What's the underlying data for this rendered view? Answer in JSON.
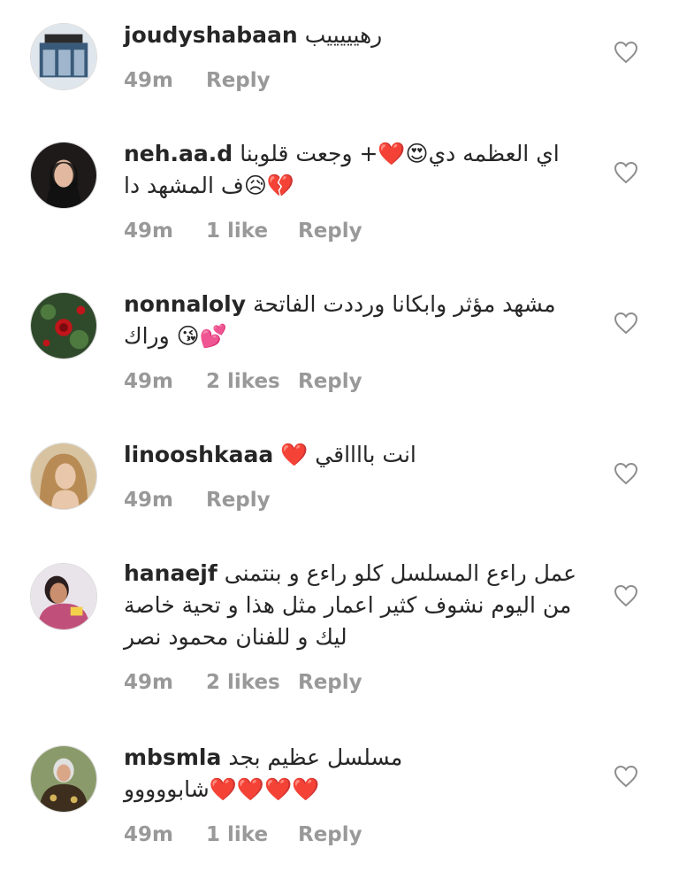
{
  "comments": [
    {
      "username": "joudyshabaan",
      "lines": [
        "رهيييييب"
      ],
      "time": "49m",
      "likes": "",
      "reply": "Reply",
      "avatar_color": "#3a5a7a"
    },
    {
      "username": "neh.aa.d",
      "lines": [
        "اي العظمه دي😍❤️+ وجعت قلوبنا",
        "💔😥ف المشهد دا"
      ],
      "time": "49m",
      "likes": "1 like",
      "reply": "Reply",
      "avatar_color": "#2a2020"
    },
    {
      "username": "nonnaloly",
      "lines": [
        "مشهد مؤثر وابكانا ورددت الفاتحة",
        "💕😘 وراك"
      ],
      "time": "49m",
      "likes": "2 likes",
      "reply": "Reply",
      "avatar_color": "#3d5a35"
    },
    {
      "username": "linooshkaaa",
      "lines": [
        "انت بااااقي ❤️"
      ],
      "time": "49m",
      "likes": "",
      "reply": "Reply",
      "avatar_color": "#c9a882"
    },
    {
      "username": "hanaejf",
      "lines": [
        "عمل راءع المسلسل كلو راءع و بنتمنى",
        "من اليوم نشوف كثير اعمار مثل هذا و تحية خاصة",
        "ليك و للفنان محمود نصر"
      ],
      "time": "49m",
      "likes": "2 likes",
      "reply": "Reply",
      "avatar_color": "#c0507a"
    },
    {
      "username": "mbsmla",
      "lines": [
        "مسلسل عظيم بجد",
        "❤️❤️❤️❤️شابووووو"
      ],
      "time": "49m",
      "likes": "1 like",
      "reply": "Reply",
      "avatar_color": "#5a6a3a"
    }
  ],
  "icons": {
    "like": "heart-outline-icon"
  }
}
